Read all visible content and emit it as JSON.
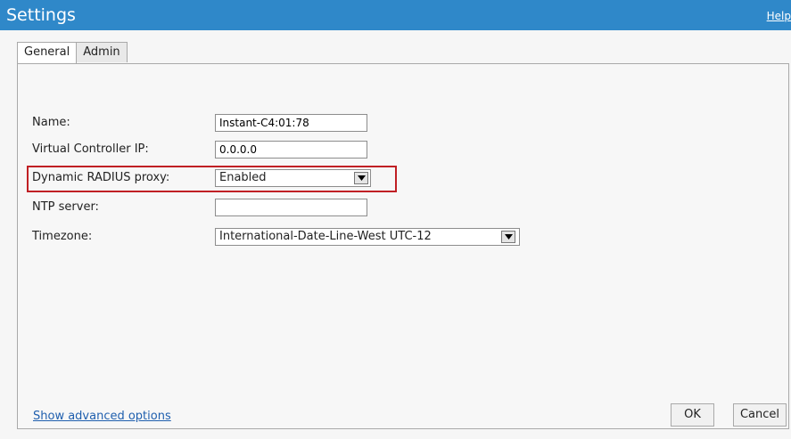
{
  "window": {
    "title": "Settings",
    "help_link": "Help"
  },
  "tabs": [
    {
      "label": "General",
      "active": true
    },
    {
      "label": "Admin",
      "active": false
    }
  ],
  "form": {
    "name_label": "Name:",
    "name_value": "Instant-C4:01:78",
    "vc_ip_label": "Virtual Controller IP:",
    "vc_ip_value": "0.0.0.0",
    "radius_label": "Dynamic RADIUS proxy:",
    "radius_value": "Enabled",
    "ntp_label": "NTP server:",
    "ntp_value": "",
    "timezone_label": "Timezone:",
    "timezone_value": "International-Date-Line-West UTC-12"
  },
  "footer": {
    "advanced_link": "Show advanced options",
    "ok_label": "OK",
    "cancel_label": "Cancel"
  },
  "colors": {
    "titlebar": "#2f88c9",
    "highlight": "#c01f24",
    "link": "#1f5fae"
  },
  "icons": {
    "dropdown_arrow": "triangle-down"
  }
}
